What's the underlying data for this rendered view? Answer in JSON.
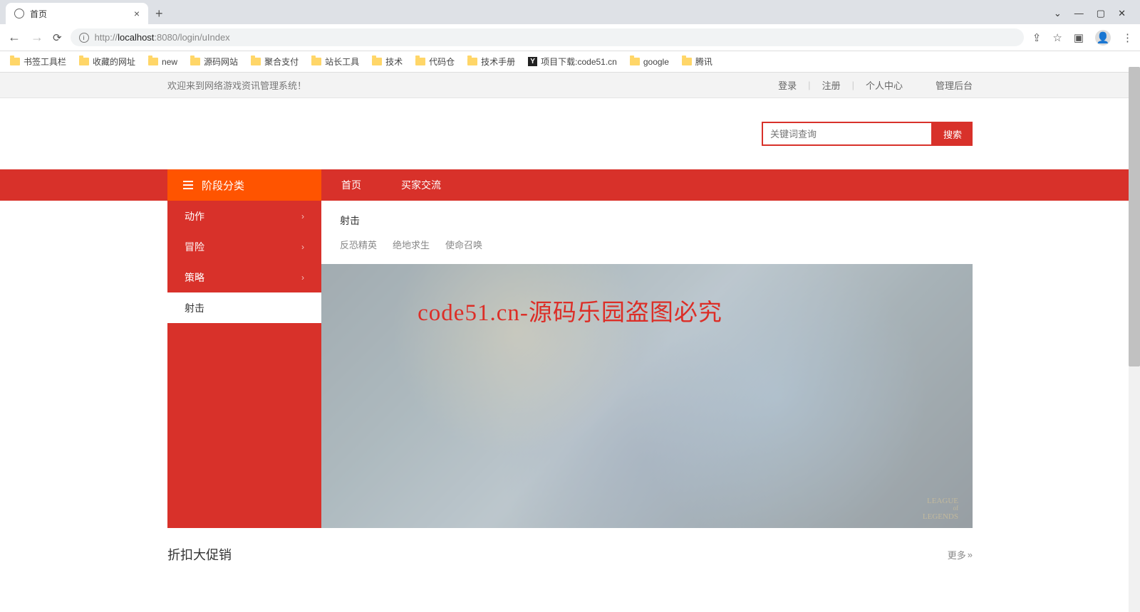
{
  "browser": {
    "tab_title": "首页",
    "url_prefix": "http://",
    "url_host": "localhost",
    "url_port_path": ":8080/login/uIndex",
    "bookmarks": [
      {
        "type": "folder",
        "label": "书签工具栏"
      },
      {
        "type": "folder",
        "label": "收藏的网址"
      },
      {
        "type": "folder",
        "label": "new"
      },
      {
        "type": "folder",
        "label": "源码网站"
      },
      {
        "type": "folder",
        "label": "聚合支付"
      },
      {
        "type": "folder",
        "label": "站长工具"
      },
      {
        "type": "folder",
        "label": "技术"
      },
      {
        "type": "folder",
        "label": "代码仓"
      },
      {
        "type": "folder",
        "label": "技术手册"
      },
      {
        "type": "y",
        "label": "项目下载:code51.cn"
      },
      {
        "type": "folder",
        "label": "google"
      },
      {
        "type": "folder",
        "label": "腾讯"
      }
    ]
  },
  "util": {
    "welcome": "欢迎来到网络游戏资讯管理系统！",
    "links": [
      "登录",
      "注册",
      "个人中心",
      "管理后台"
    ]
  },
  "search": {
    "placeholder": "关键词查询",
    "button": "搜索"
  },
  "nav": {
    "category_header": "阶段分类",
    "links": [
      "首页",
      "买家交流"
    ]
  },
  "sidebar": {
    "items": [
      {
        "label": "动作",
        "active": false,
        "arrow": true
      },
      {
        "label": "冒险",
        "active": false,
        "arrow": true
      },
      {
        "label": "策略",
        "active": false,
        "arrow": true
      },
      {
        "label": "射击",
        "active": true,
        "arrow": false
      }
    ]
  },
  "sub_panel": {
    "title": "射击",
    "links": [
      "反恐精英",
      "绝地求生",
      "使命召唤"
    ]
  },
  "banner": {
    "logo_line1": "LEAGUE",
    "logo_line2": "LEGENDS"
  },
  "watermark": "code51.cn-源码乐园盗图必究",
  "promo": {
    "title": "折扣大促销",
    "more": "更多"
  }
}
